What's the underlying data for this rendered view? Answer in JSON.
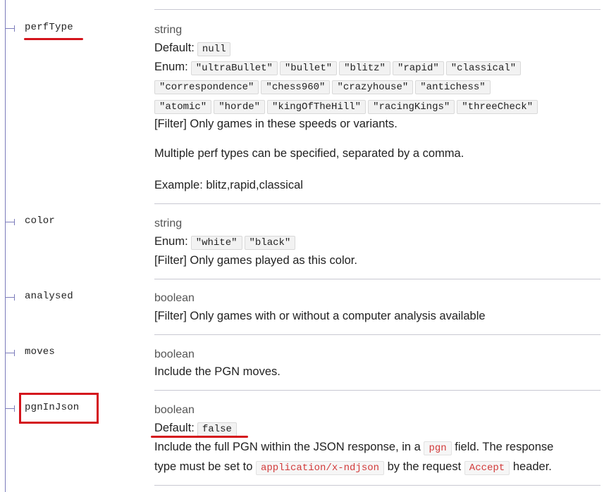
{
  "params": {
    "perfType": {
      "name": "perfType",
      "type": "string",
      "default_label": "Default:",
      "default_value": "null",
      "enum_label": "Enum:",
      "enum": [
        "\"ultraBullet\"",
        "\"bullet\"",
        "\"blitz\"",
        "\"rapid\"",
        "\"classical\"",
        "\"correspondence\"",
        "\"chess960\"",
        "\"crazyhouse\"",
        "\"antichess\"",
        "\"atomic\"",
        "\"horde\"",
        "\"kingOfTheHill\"",
        "\"racingKings\"",
        "\"threeCheck\""
      ],
      "desc1": "[Filter] Only games in these speeds or variants.",
      "desc2": "Multiple perf types can be specified, separated by a comma.",
      "desc3": "Example: blitz,rapid,classical"
    },
    "color": {
      "name": "color",
      "type": "string",
      "enum_label": "Enum:",
      "enum": [
        "\"white\"",
        "\"black\""
      ],
      "desc": "[Filter] Only games played as this color."
    },
    "analysed": {
      "name": "analysed",
      "type": "boolean",
      "desc": "[Filter] Only games with or without a computer analysis available"
    },
    "moves": {
      "name": "moves",
      "type": "boolean",
      "desc": "Include the PGN moves."
    },
    "pgnInJson": {
      "name": "pgnInJson",
      "type": "boolean",
      "default_label": "Default:",
      "default_value": "false",
      "desc_a": "Include the full PGN within the JSON response, in a",
      "code_pgn": "pgn",
      "desc_b": "field. The response",
      "desc_c": "type must be set to",
      "code_mime": "application/x-ndjson",
      "desc_d": "by the request",
      "code_accept": "Accept",
      "desc_e": "header."
    }
  },
  "highlight_color": "#d4141c"
}
